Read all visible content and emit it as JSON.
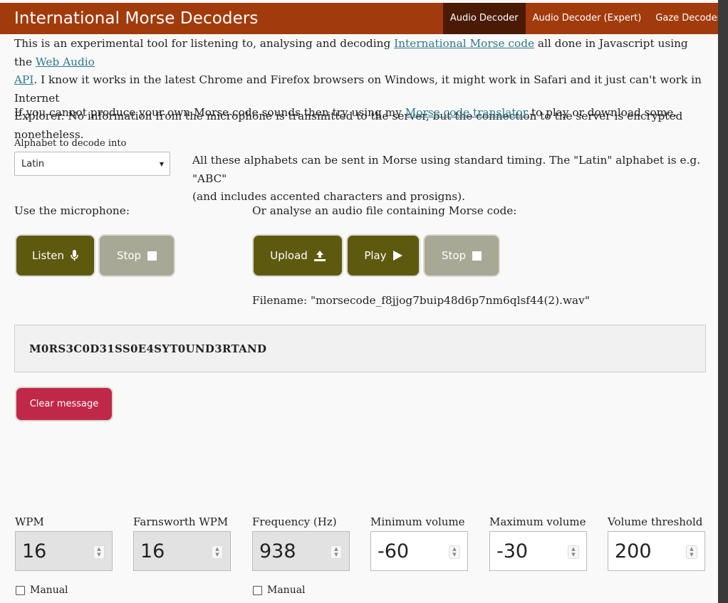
{
  "nav": {
    "brand": "International Morse Decoders",
    "links": [
      "Audio Decoder",
      "Audio Decoder (Expert)",
      "Gaze Decoder"
    ]
  },
  "intro": {
    "t1": "This is an experimental tool for listening to, analysing and decoding ",
    "link1": "International Morse code",
    "t2": " all done in Javascript using the ",
    "link2a": "Web Audio",
    "link2b": "API",
    "t3": ". I know it works in the latest Chrome and Firefox browsers on Windows, it might work in Safari and it just can't work in Internet",
    "t4": "Explorer. No information from the microphone is transmitted to the server, but the connection to the server is encrypted nonetheless."
  },
  "translator": {
    "t1": "If you cannot produce your own Morse code sounds then try using my ",
    "link": "Morse code translator",
    "t2": " to play or download some."
  },
  "alphabet": {
    "label": "Alphabet to decode into",
    "selected": "Latin",
    "desc1": "All these alphabets can be sent in Morse using standard timing. The \"Latin\" alphabet is e.g. \"ABC\"",
    "desc2": "(and includes accented characters and prosigns)."
  },
  "mic": {
    "label": "Use the microphone:",
    "listen": "Listen",
    "stop": "Stop"
  },
  "file": {
    "label": "Or analyse an audio file containing Morse code:",
    "upload": "Upload",
    "play": "Play",
    "stop": "Stop",
    "filename": "Filename: \"morsecode_f8jjog7buip48d6p7nm6qlsf44(2).wav\""
  },
  "message": {
    "text": "M0RS3C0D31SS0E4SYT0UND3RTAND",
    "clear": "Clear message"
  },
  "settings": {
    "wpm": {
      "label": "WPM",
      "value": "16"
    },
    "farnsworth": {
      "label": "Farnsworth WPM",
      "value": "16"
    },
    "frequency": {
      "label": "Frequency (Hz)",
      "value": "938"
    },
    "minvol": {
      "label": "Minimum volume",
      "value": "-60"
    },
    "maxvol": {
      "label": "Maximum volume",
      "value": "-30"
    },
    "threshold": {
      "label": "Volume threshold",
      "value": "200"
    },
    "manual": "Manual"
  }
}
